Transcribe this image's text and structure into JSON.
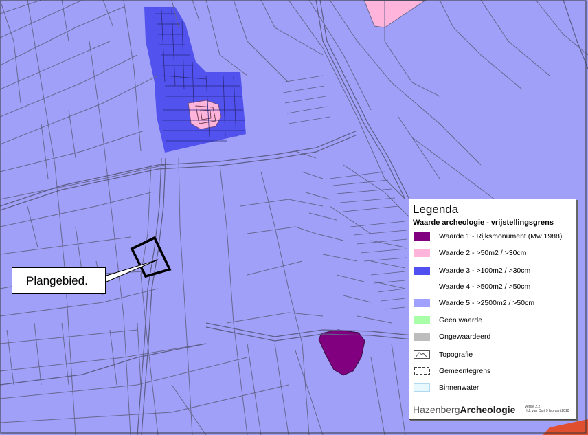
{
  "callout": {
    "label": "Plangebied."
  },
  "legend": {
    "title": "Legenda",
    "subtitle": "Waarde archeologie - vrijstellingsgrens",
    "items": [
      {
        "label": "Waarde 1 - Rijksmonument (Mw 1988)",
        "color": "#800080"
      },
      {
        "label": "Waarde 2 - >50m2 / >30cm",
        "color": "#ffb4dc"
      },
      {
        "label": "Waarde 3 - >100m2 / >30cm",
        "color": "#5050f0"
      },
      {
        "label": "Waarde 4 - >500m2 / >50cm",
        "color": "#e06060"
      },
      {
        "label": "Waarde 5 - >2500m2 / >50cm",
        "color": "#a0a0ff"
      },
      {
        "label": "Geen waarde",
        "color": "#a8ffa8"
      },
      {
        "label": "Ongewaardeerd",
        "color": "#bdbdbd"
      },
      {
        "label": "Topografie",
        "icon": "topografie-icon"
      },
      {
        "label": "Gemeentegrens",
        "icon": "boundary-icon"
      },
      {
        "label": "Binnenwater",
        "color": "#e8f8ff"
      }
    ],
    "brand": {
      "part1": "Hazenberg",
      "part2": "Archeologie"
    },
    "version": {
      "line1": "Versie 2.2",
      "line2": "H.J. van Oort 9 februari 2010"
    }
  }
}
